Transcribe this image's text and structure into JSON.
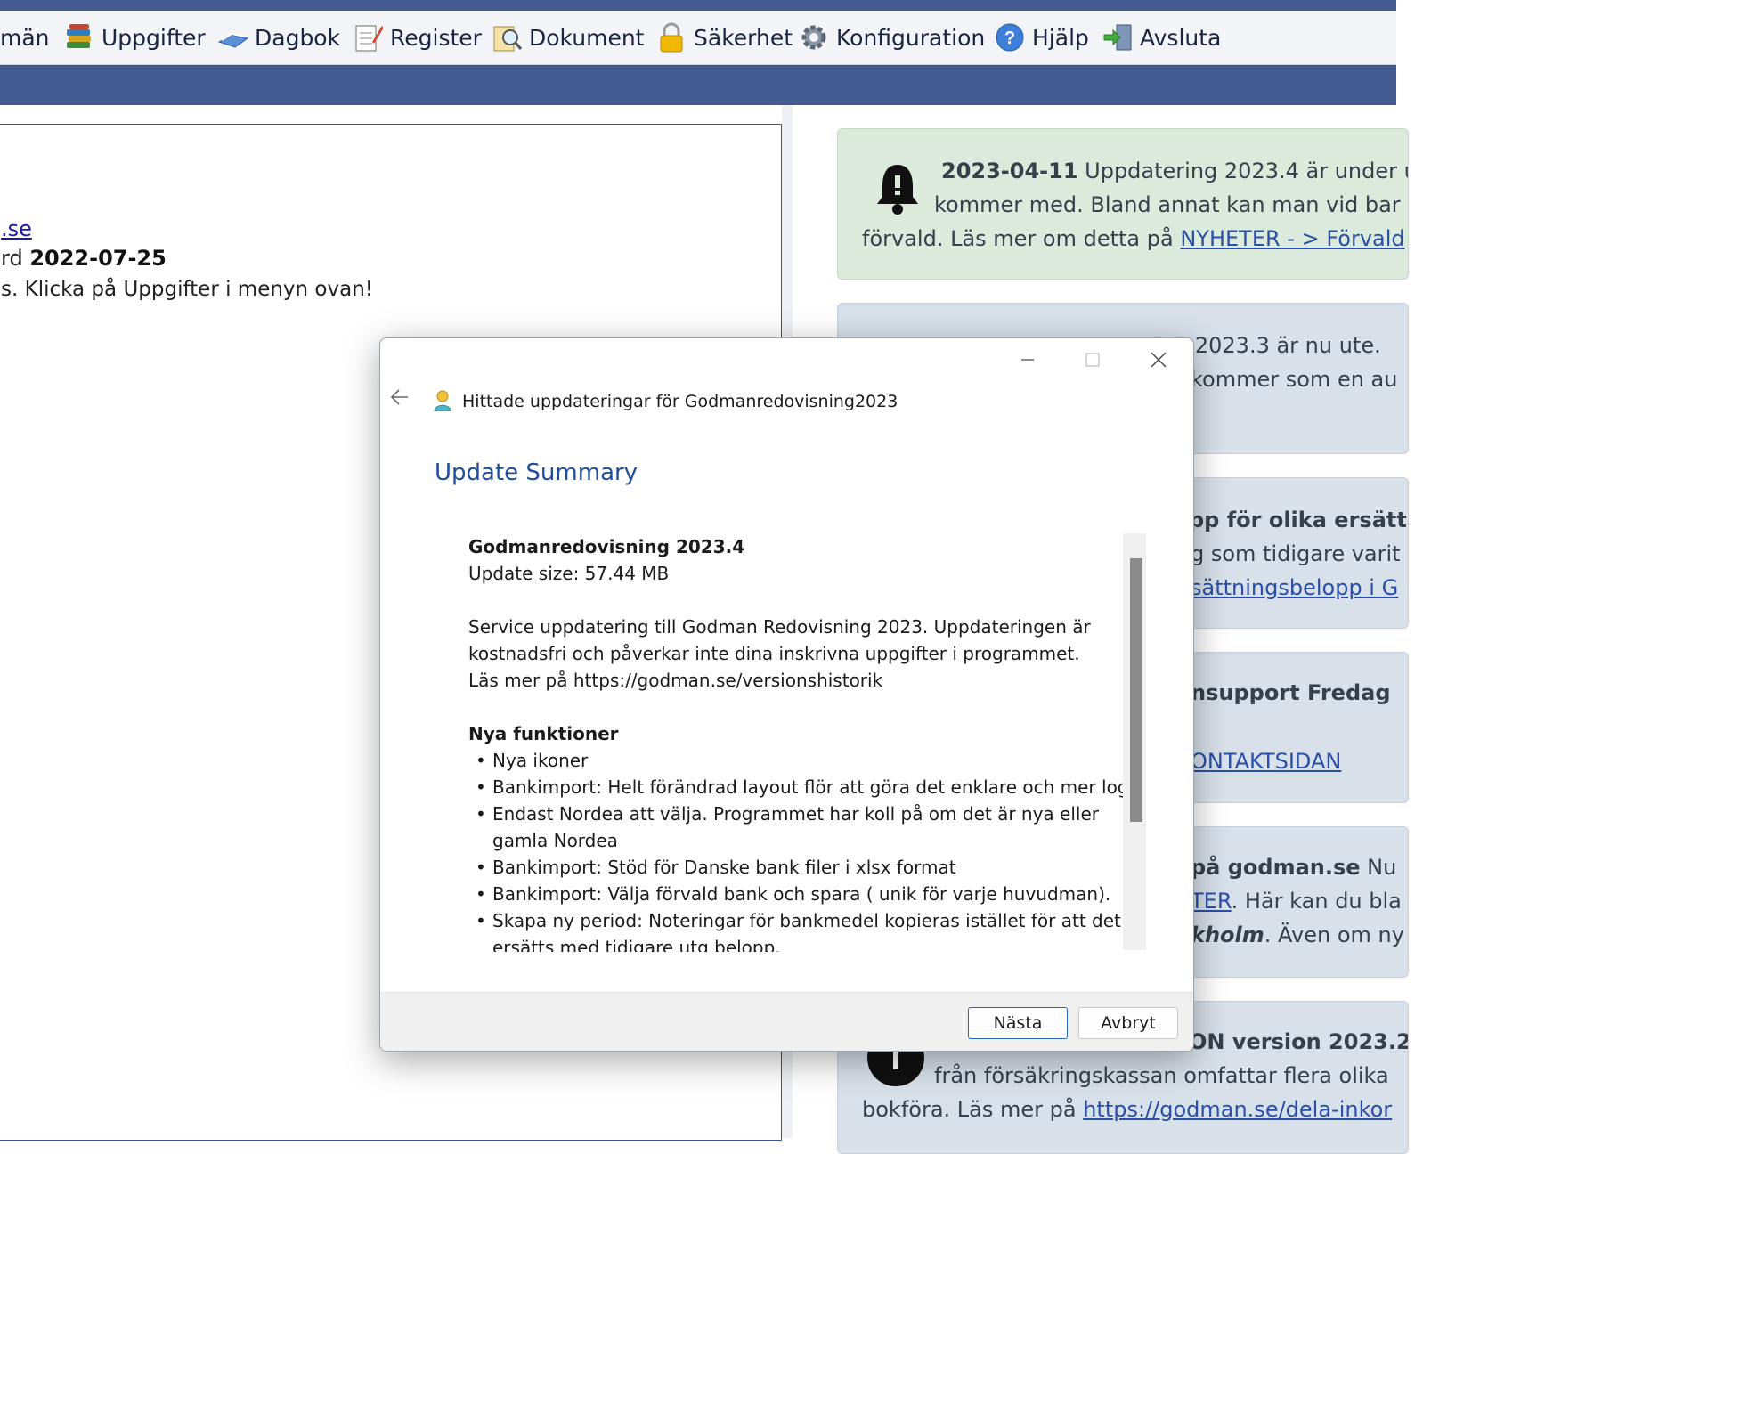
{
  "menu": [
    {
      "label": "män",
      "icon": "people-icon"
    },
    {
      "label": "Uppgifter",
      "icon": "books-icon"
    },
    {
      "label": "Dagbok",
      "icon": "open-book-icon"
    },
    {
      "label": "Register",
      "icon": "notepad-icon"
    },
    {
      "label": "Dokument",
      "icon": "document-search-icon"
    },
    {
      "label": "Säkerhet",
      "icon": "padlock-icon"
    },
    {
      "label": "Konfiguration",
      "icon": "gear-icon"
    },
    {
      "label": "Hjälp",
      "icon": "help-icon"
    },
    {
      "label": "Avsluta",
      "icon": "exit-door-icon"
    }
  ],
  "left": {
    "link": ".se",
    "date_prefix": "rd ",
    "date": "2022-07-25",
    "text": "s. Klicka på Uppgifter i menyn ovan!"
  },
  "news": [
    {
      "date": "2023-04-11",
      "line1": " Uppdatering 2023.4 är under u",
      "line2": "kommer med. Bland annat kan man vid bar",
      "line3_prefix": "förvald. Läs mer om detta på ",
      "line3_link": "NYHETER - > Förvald"
    },
    {
      "line1": "g 2023.3 är nu ute.",
      "line2": "kommer som en au"
    },
    {
      "line1": "pp för olika ersätt",
      "line2": "g som tidigare varit",
      "line3_link": "sättningsbelopp i G"
    },
    {
      "line1": "nsupport Fredag ",
      "line3_link": "ONTAKTSIDAN"
    },
    {
      "line1_bold": " på godman.se",
      "line1_rest": " Nu",
      "line2_link": "TER",
      "line2_rest": ".  Här kan du bla",
      "line3_italic": "kholm",
      "line3_rest": ". Även om ny"
    },
    {
      "line1": "ON version 2023.2",
      "line2": "från försäkringskassan omfattar flera olika",
      "line3_prefix": "bokföra. Läs mer på ",
      "line3_link": "https://godman.se/dela-inkor"
    }
  ],
  "dialog": {
    "title": "Hittade uppdateringar för Godmanredovisning2023",
    "heading": "Update Summary",
    "product": "Godmanredovisning 2023.4",
    "size": "Update size: 57.44 MB",
    "desc1": "Service uppdatering till Godman Redovisning 2023. Uppdateringen är",
    "desc2": "kostnadsfri och påverkar inte dina inskrivna uppgifter i programmet.",
    "desc3": "Läs mer på https://godman.se/versionshistorik",
    "section": "Nya funktioner",
    "bullets": [
      "Nya ikoner",
      "Bankimport: Helt förändrad layout flör att göra det enklare och mer logistk",
      "Endast Nordea att välja. Programmet har koll på om det är nya eller gamla Nordea",
      "Bankimport: Stöd för Danske bank filer i xlsx format",
      "Bankimport: Välja förvald bank och spara ( unik för varje huvudman).",
      "Skapa ny period: Noteringar för bankmedel kopieras istället för att det ersätts med tidigare utg belopp."
    ],
    "next": "Nästa",
    "cancel": "Avbryt"
  }
}
